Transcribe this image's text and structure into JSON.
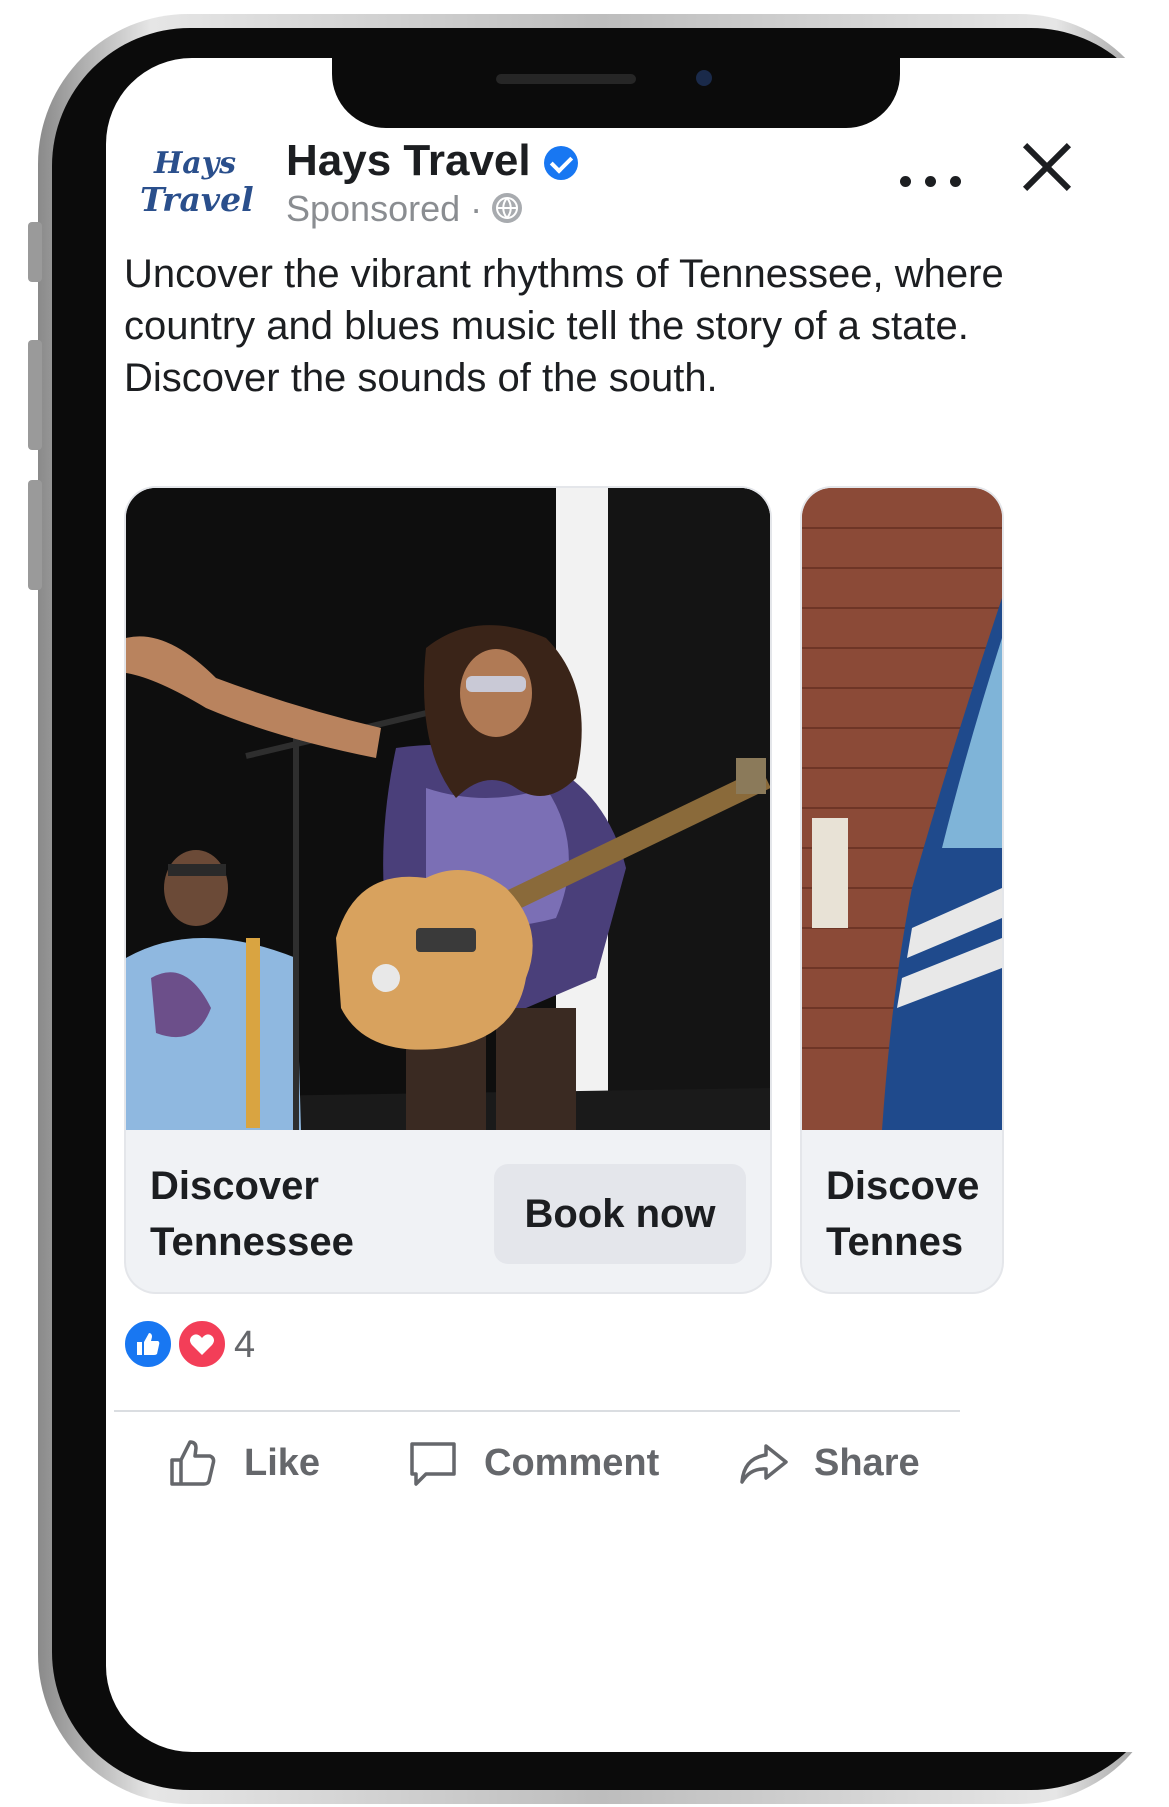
{
  "post": {
    "logo": {
      "line1": "Hays",
      "line2": "Travel"
    },
    "page_name": "Hays Travel",
    "sponsored_label": "Sponsored ·",
    "caption": [
      "Uncover the vibrant rhythms of Tennessee, where country and blues music tell the story of a state.",
      "Discover the sounds of the south."
    ]
  },
  "carousel": {
    "cards": [
      {
        "title_line1": "Discover",
        "title_line2": "Tennessee",
        "cta_label": "Book now"
      },
      {
        "title_line1": "Discove",
        "title_line2": "Tennes"
      }
    ]
  },
  "reactions": {
    "count": "4"
  },
  "actions": {
    "like": "Like",
    "comment": "Comment",
    "share": "Share"
  },
  "colors": {
    "verified": "#1877f2",
    "like": "#1877f2",
    "love": "#f33e58",
    "logo": "#2a4f8c"
  },
  "icons": [
    "verified-badge-icon",
    "globe-icon",
    "more-options-icon",
    "close-icon",
    "like-reaction-icon",
    "love-reaction-icon",
    "thumbs-up-icon",
    "comment-bubble-icon",
    "share-arrow-icon"
  ]
}
